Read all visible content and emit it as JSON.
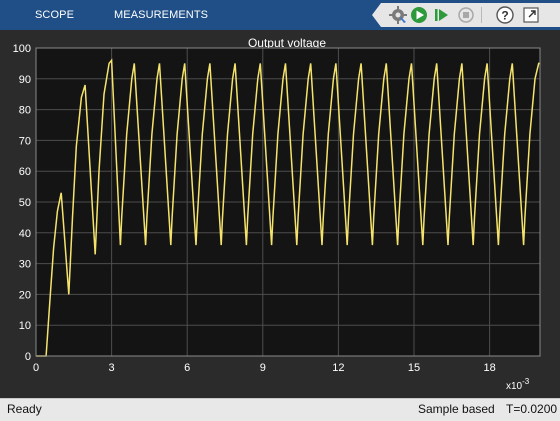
{
  "toolstrip": {
    "tabs": [
      "SCOPE",
      "MEASUREMENTS"
    ],
    "buttons": [
      {
        "icon": "settings-icon"
      },
      {
        "icon": "run-icon"
      },
      {
        "icon": "step-forward-icon"
      },
      {
        "icon": "stop-icon"
      },
      {
        "icon": "help-icon"
      },
      {
        "icon": "undock-icon"
      }
    ],
    "accent": "#1f4f86"
  },
  "plot": {
    "background": "#141414",
    "trace_color": "#f5e46c",
    "grid_color": "#4d4d4d"
  },
  "chart_data": {
    "type": "line",
    "title": "Output voltage",
    "xlabel": "",
    "ylabel": "",
    "x_exponent_label": "x10-3",
    "xlim": [
      0,
      20
    ],
    "ylim": [
      0,
      100
    ],
    "x_ticks": [
      0,
      3,
      6,
      9,
      12,
      15,
      18
    ],
    "y_ticks": [
      0,
      10,
      20,
      30,
      40,
      50,
      60,
      70,
      80,
      90,
      100
    ],
    "grid": true,
    "x_unit_scale": "ms (x10^-3 s)",
    "series": [
      {
        "name": "",
        "x": [
          0,
          0.4,
          0.55,
          0.7,
          0.85,
          1.0,
          1.3,
          1.45,
          1.6,
          1.8,
          1.95,
          2.35,
          2.5,
          2.7,
          2.9,
          3.0,
          3.35,
          3.4,
          3.6,
          3.8,
          3.9,
          4.35,
          4.4,
          4.6,
          4.8,
          4.9,
          5.35,
          5.4,
          5.6,
          5.8,
          5.9,
          6.35,
          6.4,
          6.6,
          6.8,
          6.9,
          7.35,
          7.4,
          7.6,
          7.8,
          7.9,
          8.35,
          8.4,
          8.6,
          8.8,
          8.9,
          9.35,
          9.4,
          9.6,
          9.8,
          9.9,
          10.35,
          10.4,
          10.6,
          10.8,
          10.9,
          11.35,
          11.4,
          11.6,
          11.8,
          11.9,
          12.35,
          12.4,
          12.6,
          12.8,
          12.9,
          13.35,
          13.4,
          13.6,
          13.8,
          13.9,
          14.35,
          14.4,
          14.6,
          14.8,
          14.9,
          15.35,
          15.4,
          15.6,
          15.8,
          15.9,
          16.35,
          16.4,
          16.6,
          16.8,
          16.9,
          17.35,
          17.4,
          17.6,
          17.8,
          17.9,
          18.35,
          18.4,
          18.6,
          18.8,
          18.9,
          19.35,
          19.4,
          19.6,
          19.8,
          19.95,
          20.0
        ],
        "y": [
          0,
          0,
          18,
          35,
          47,
          53,
          20,
          45,
          68,
          84,
          88,
          33,
          60,
          85,
          95,
          96,
          36,
          45,
          72,
          90,
          95,
          36,
          45,
          72,
          90,
          95,
          36,
          45,
          72,
          90,
          95,
          36,
          45,
          72,
          90,
          95,
          36,
          45,
          72,
          90,
          95,
          36,
          45,
          72,
          90,
          95,
          36,
          45,
          72,
          90,
          95,
          36,
          45,
          72,
          90,
          95,
          36,
          45,
          72,
          90,
          95,
          36,
          45,
          72,
          90,
          95,
          36,
          45,
          72,
          90,
          95,
          36,
          45,
          72,
          90,
          95,
          36,
          45,
          72,
          90,
          95,
          36,
          45,
          72,
          90,
          95,
          36,
          45,
          72,
          90,
          95,
          36,
          45,
          72,
          90,
          95,
          36,
          45,
          72,
          90,
          95,
          95
        ]
      }
    ]
  },
  "status": {
    "left": "Ready",
    "mode": "Sample based",
    "time": "T=0.0200"
  }
}
